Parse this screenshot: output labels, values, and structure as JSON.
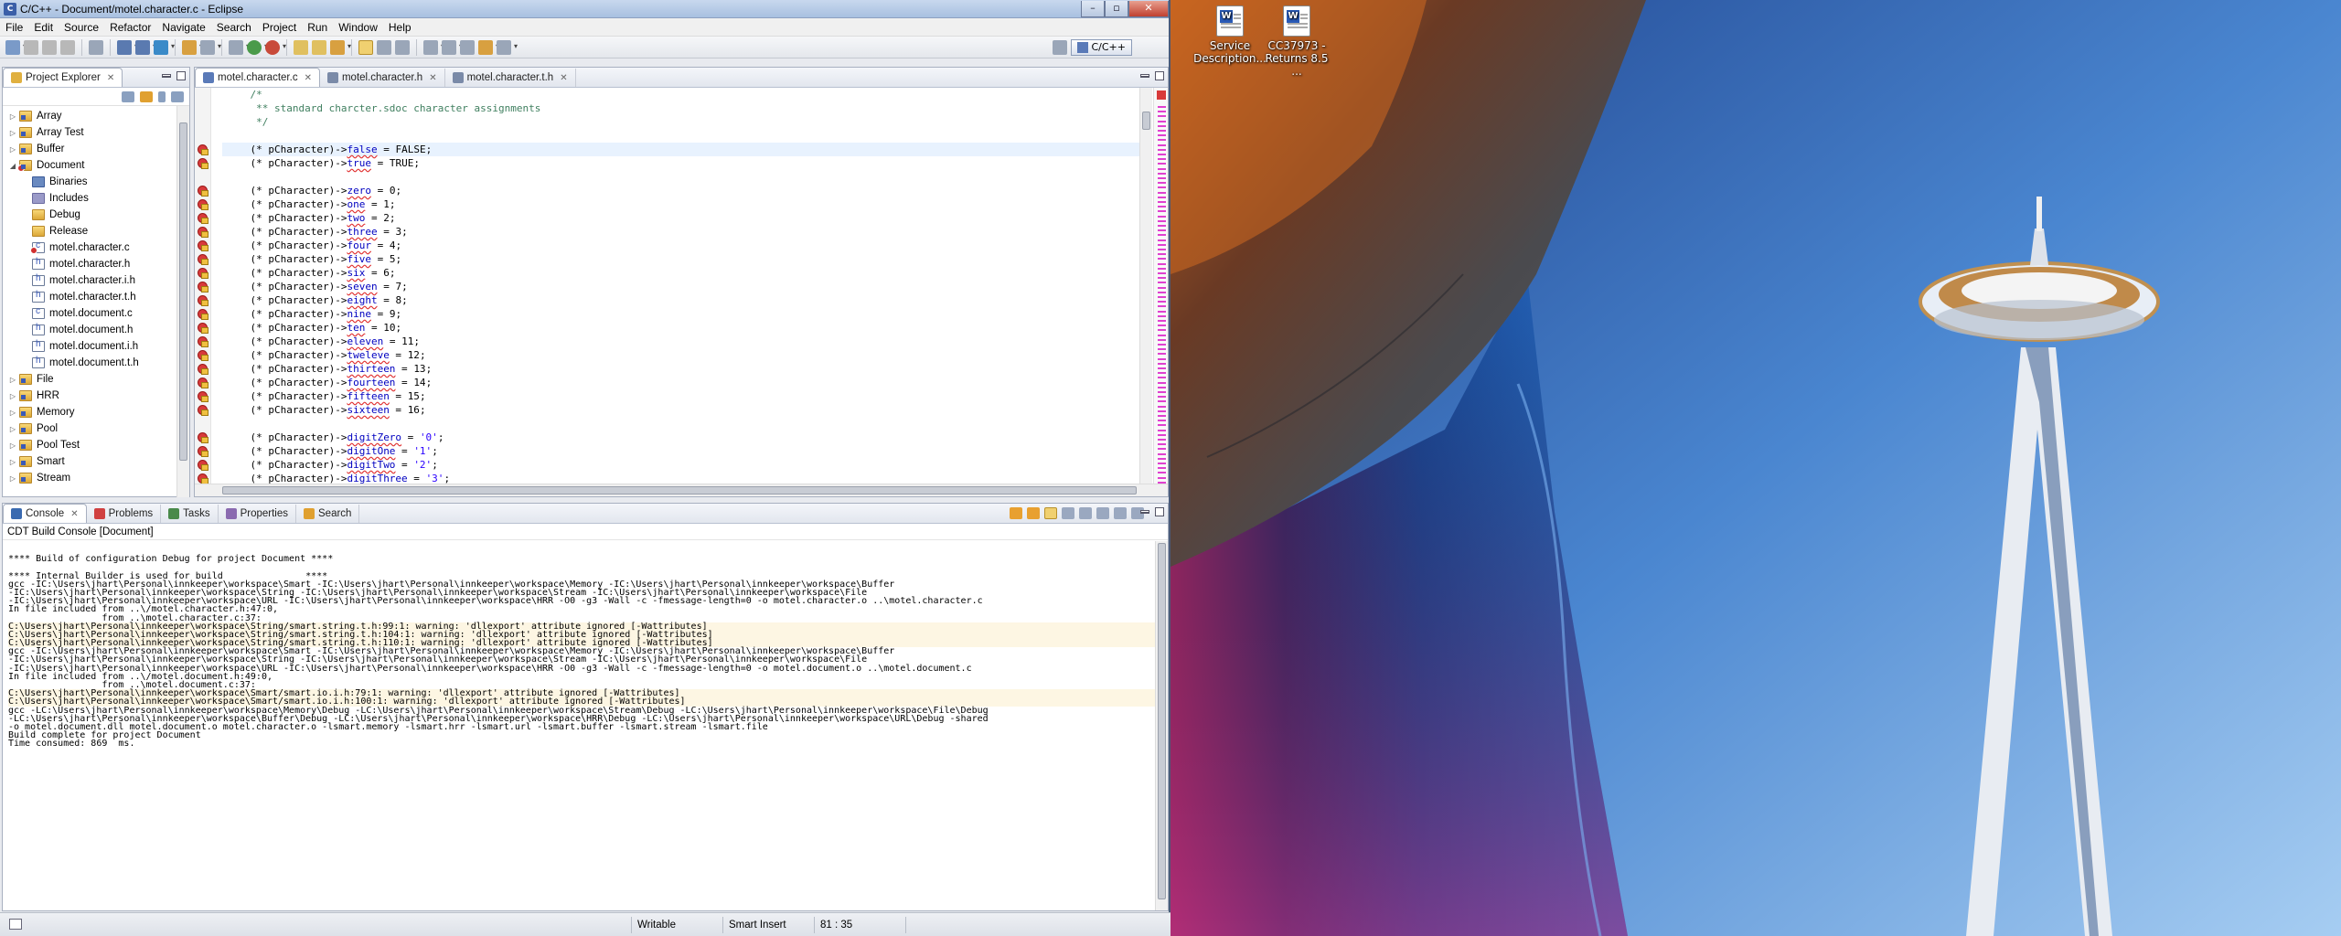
{
  "window": {
    "title": "C/C++ - Document/motel.character.c - Eclipse"
  },
  "menu": [
    "File",
    "Edit",
    "Source",
    "Refactor",
    "Navigate",
    "Search",
    "Project",
    "Run",
    "Window",
    "Help"
  ],
  "perspective": {
    "label": "C/C++"
  },
  "explorer": {
    "tab": "Project Explorer",
    "items": [
      {
        "label": "Array",
        "icon": "folder-icon",
        "kind": "proj",
        "depth": 0
      },
      {
        "label": "Array Test",
        "icon": "folder-icon",
        "kind": "proj",
        "depth": 0
      },
      {
        "label": "Buffer",
        "icon": "folder-icon",
        "kind": "proj",
        "depth": 0
      },
      {
        "label": "Document",
        "icon": "folder-icon",
        "kind": "proj err",
        "depth": 0,
        "expanded": true
      },
      {
        "label": "Binaries",
        "icon": "binaries-icon",
        "kind": "bin",
        "depth": 1
      },
      {
        "label": "Includes",
        "icon": "includes-icon",
        "kind": "inc",
        "depth": 1
      },
      {
        "label": "Debug",
        "icon": "folder-icon",
        "kind": "folder",
        "depth": 1
      },
      {
        "label": "Release",
        "icon": "folder-icon",
        "kind": "folder",
        "depth": 1
      },
      {
        "label": "motel.character.c",
        "icon": "c-file-icon",
        "kind": "cfile cerr",
        "depth": 1
      },
      {
        "label": "motel.character.h",
        "icon": "h-file-icon",
        "kind": "hfile",
        "depth": 1
      },
      {
        "label": "motel.character.i.h",
        "icon": "h-file-icon",
        "kind": "hfile",
        "depth": 1
      },
      {
        "label": "motel.character.t.h",
        "icon": "h-file-icon",
        "kind": "hfile",
        "depth": 1
      },
      {
        "label": "motel.document.c",
        "icon": "c-file-icon",
        "kind": "cfile",
        "depth": 1
      },
      {
        "label": "motel.document.h",
        "icon": "h-file-icon",
        "kind": "hfile",
        "depth": 1
      },
      {
        "label": "motel.document.i.h",
        "icon": "h-file-icon",
        "kind": "hfile",
        "depth": 1
      },
      {
        "label": "motel.document.t.h",
        "icon": "h-file-icon",
        "kind": "hfile",
        "depth": 1
      },
      {
        "label": "File",
        "icon": "folder-icon",
        "kind": "proj",
        "depth": 0
      },
      {
        "label": "HRR",
        "icon": "folder-icon",
        "kind": "proj",
        "depth": 0
      },
      {
        "label": "Memory",
        "icon": "folder-icon",
        "kind": "proj",
        "depth": 0
      },
      {
        "label": "Pool",
        "icon": "folder-icon",
        "kind": "proj",
        "depth": 0
      },
      {
        "label": "Pool Test",
        "icon": "folder-icon",
        "kind": "proj",
        "depth": 0
      },
      {
        "label": "Smart",
        "icon": "folder-icon",
        "kind": "proj",
        "depth": 0
      },
      {
        "label": "Stream",
        "icon": "folder-icon",
        "kind": "proj",
        "depth": 0
      }
    ]
  },
  "editor": {
    "tabs": [
      {
        "label": "motel.character.c",
        "active": true
      },
      {
        "label": "motel.character.h",
        "active": false
      },
      {
        "label": "motel.character.t.h",
        "active": false
      }
    ],
    "lines": [
      {
        "t": "    /*",
        "c": "cm"
      },
      {
        "t": "     ** standard charcter.sdoc character assignments",
        "c": "cm"
      },
      {
        "t": "     */",
        "c": "cm"
      },
      {
        "t": "",
        "c": ""
      },
      {
        "field": "false",
        "val": "FALSE",
        "cursor": true
      },
      {
        "field": "true",
        "val": "TRUE"
      },
      {
        "t": "",
        "c": ""
      },
      {
        "field": "zero",
        "val": "0"
      },
      {
        "field": "one",
        "val": "1"
      },
      {
        "field": "two",
        "val": "2"
      },
      {
        "field": "three",
        "val": "3"
      },
      {
        "field": "four",
        "val": "4"
      },
      {
        "field": "five",
        "val": "5"
      },
      {
        "field": "six",
        "val": "6"
      },
      {
        "field": "seven",
        "val": "7"
      },
      {
        "field": "eight",
        "val": "8"
      },
      {
        "field": "nine",
        "val": "9"
      },
      {
        "field": "ten",
        "val": "10"
      },
      {
        "field": "eleven",
        "val": "11"
      },
      {
        "field": "tweleve",
        "val": "12"
      },
      {
        "field": "thirteen",
        "val": "13"
      },
      {
        "field": "fourteen",
        "val": "14"
      },
      {
        "field": "fifteen",
        "val": "15"
      },
      {
        "field": "sixteen",
        "val": "16"
      },
      {
        "t": "",
        "c": ""
      },
      {
        "field": "digitZero",
        "val": "'0'",
        "str": true
      },
      {
        "field": "digitOne",
        "val": "'1'",
        "str": true
      },
      {
        "field": "digitTwo",
        "val": "'2'",
        "str": true
      },
      {
        "field": "digitThree",
        "val": "'3'",
        "str": true
      }
    ],
    "prefix": "    (* pCharacter)->"
  },
  "bottom": {
    "tabs": [
      "Console",
      "Problems",
      "Tasks",
      "Properties",
      "Search"
    ],
    "console_title": "CDT Build Console [Document]",
    "output": [
      {
        "t": "",
        "w": false
      },
      {
        "t": "**** Build of configuration Debug for project Document ****",
        "w": false
      },
      {
        "t": "",
        "w": false
      },
      {
        "t": "**** Internal Builder is used for build               ****",
        "w": false
      },
      {
        "t": "gcc -IC:\\Users\\jhart\\Personal\\innkeeper\\workspace\\Smart -IC:\\Users\\jhart\\Personal\\innkeeper\\workspace\\Memory -IC:\\Users\\jhart\\Personal\\innkeeper\\workspace\\Buffer",
        "w": false
      },
      {
        "t": "-IC:\\Users\\jhart\\Personal\\innkeeper\\workspace\\String -IC:\\Users\\jhart\\Personal\\innkeeper\\workspace\\Stream -IC:\\Users\\jhart\\Personal\\innkeeper\\workspace\\File",
        "w": false
      },
      {
        "t": "-IC:\\Users\\jhart\\Personal\\innkeeper\\workspace\\URL -IC:\\Users\\jhart\\Personal\\innkeeper\\workspace\\HRR -O0 -g3 -Wall -c -fmessage-length=0 -o motel.character.o ..\\motel.character.c",
        "w": false
      },
      {
        "t": "In file included from ..\\/motel.character.h:47:0,",
        "w": false
      },
      {
        "t": "                 from ..\\motel.character.c:37:",
        "w": false
      },
      {
        "t": "C:\\Users\\jhart\\Personal\\innkeeper\\workspace\\String/smart.string.t.h:99:1: warning: 'dllexport' attribute ignored [-Wattributes]",
        "w": true
      },
      {
        "t": "C:\\Users\\jhart\\Personal\\innkeeper\\workspace\\String/smart.string.t.h:104:1: warning: 'dllexport' attribute ignored [-Wattributes]",
        "w": true
      },
      {
        "t": "C:\\Users\\jhart\\Personal\\innkeeper\\workspace\\String/smart.string.t.h:110:1: warning: 'dllexport' attribute ignored [-Wattributes]",
        "w": true
      },
      {
        "t": "gcc -IC:\\Users\\jhart\\Personal\\innkeeper\\workspace\\Smart -IC:\\Users\\jhart\\Personal\\innkeeper\\workspace\\Memory -IC:\\Users\\jhart\\Personal\\innkeeper\\workspace\\Buffer",
        "w": false
      },
      {
        "t": "-IC:\\Users\\jhart\\Personal\\innkeeper\\workspace\\String -IC:\\Users\\jhart\\Personal\\innkeeper\\workspace\\Stream -IC:\\Users\\jhart\\Personal\\innkeeper\\workspace\\File",
        "w": false
      },
      {
        "t": "-IC:\\Users\\jhart\\Personal\\innkeeper\\workspace\\URL -IC:\\Users\\jhart\\Personal\\innkeeper\\workspace\\HRR -O0 -g3 -Wall -c -fmessage-length=0 -o motel.document.o ..\\motel.document.c",
        "w": false
      },
      {
        "t": "In file included from ..\\/motel.document.h:49:0,",
        "w": false
      },
      {
        "t": "                 from ..\\motel.document.c:37:",
        "w": false
      },
      {
        "t": "C:\\Users\\jhart\\Personal\\innkeeper\\workspace\\Smart/smart.io.i.h:79:1: warning: 'dllexport' attribute ignored [-Wattributes]",
        "w": true
      },
      {
        "t": "C:\\Users\\jhart\\Personal\\innkeeper\\workspace\\Smart/smart.io.i.h:100:1: warning: 'dllexport' attribute ignored [-Wattributes]",
        "w": true
      },
      {
        "t": "gcc -LC:\\Users\\jhart\\Personal\\innkeeper\\workspace\\Memory\\Debug -LC:\\Users\\jhart\\Personal\\innkeeper\\workspace\\Stream\\Debug -LC:\\Users\\jhart\\Personal\\innkeeper\\workspace\\File\\Debug",
        "w": false
      },
      {
        "t": "-LC:\\Users\\jhart\\Personal\\innkeeper\\workspace\\Buffer\\Debug -LC:\\Users\\jhart\\Personal\\innkeeper\\workspace\\HRR\\Debug -LC:\\Users\\jhart\\Personal\\innkeeper\\workspace\\URL\\Debug -shared",
        "w": false
      },
      {
        "t": "-o motel.document.dll motel.document.o motel.character.o -lsmart.memory -lsmart.hrr -lsmart.url -lsmart.buffer -lsmart.stream -lsmart.file",
        "w": false
      },
      {
        "t": "Build complete for project Document",
        "w": false
      },
      {
        "t": "Time consumed: 869  ms.",
        "w": false
      }
    ]
  },
  "status": {
    "writable": "Writable",
    "insert_mode": "Smart Insert",
    "position": "81 : 35"
  },
  "desktop": {
    "icons": [
      {
        "label": "Service Description...",
        "icon": "word-document-icon"
      },
      {
        "label": "CC37973 - Returns 8.5 ...",
        "icon": "word-document-icon"
      }
    ]
  },
  "colors": {
    "comment": "#3f7f5f",
    "field": "#0000c0",
    "warning_bg": "#fdf6e3",
    "error_marker": "#d83a3a"
  }
}
